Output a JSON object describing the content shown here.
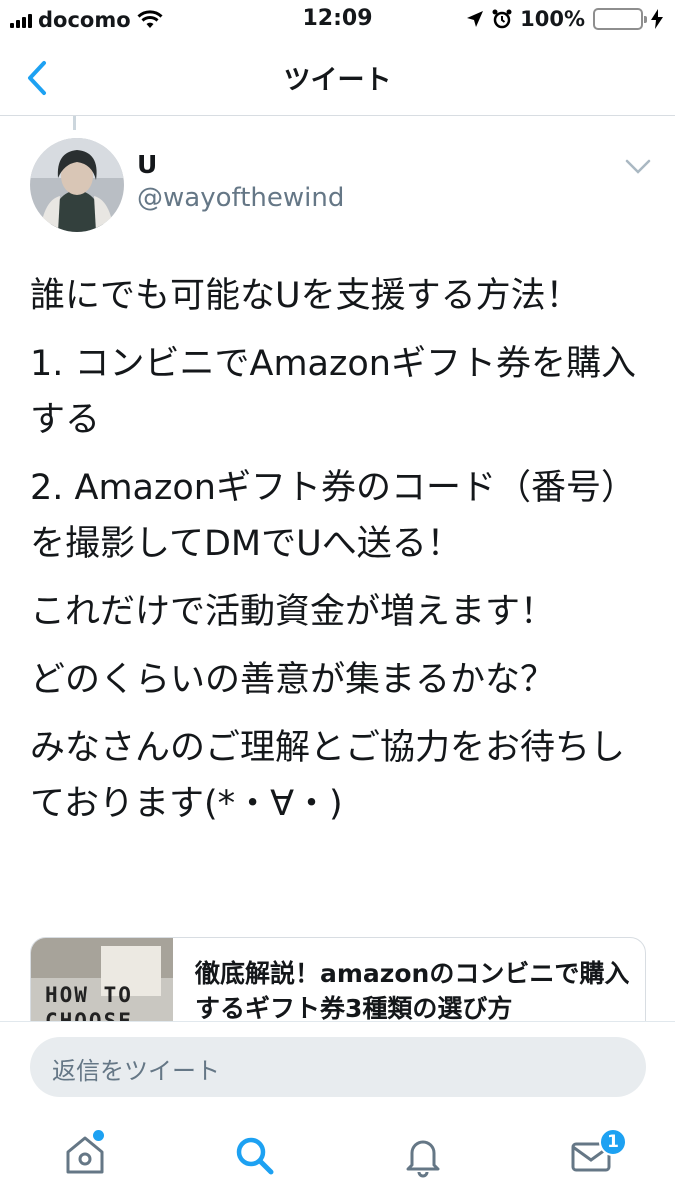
{
  "status_bar": {
    "carrier": "docomo",
    "time": "12:09",
    "battery": "100%",
    "battery_level": 1.0
  },
  "nav": {
    "title": "ツイート"
  },
  "tweet": {
    "author_name": "U",
    "author_handle": "@wayofthewind",
    "lines": [
      "誰にでも可能なUを支援する方法！",
      "1. コンビニでAmazonギフト券を購入する",
      "2. Amazonギフト券のコード（番号）を撮影してDMでUへ送る！",
      "これだけで活動資金が増えます！",
      "どのくらいの善意が集まるかな？",
      "みなさんのご理解とご協力をお待ちしております(*・∀・)"
    ]
  },
  "link_card": {
    "thumb_text": "HOW TO CHOOSE",
    "title": "徹底解説！amazonのコンビニで購入するギフト券3種類の選び方"
  },
  "reply": {
    "placeholder": "返信をツイート"
  },
  "tabbar": {
    "tabs": [
      {
        "icon": "home-icon",
        "active": false,
        "has_dot": true
      },
      {
        "icon": "search-icon",
        "active": true
      },
      {
        "icon": "bell-icon",
        "active": false
      },
      {
        "icon": "mail-icon",
        "active": false
      }
    ],
    "messages_badge": "1"
  },
  "colors": {
    "accent": "#1da1f2",
    "text": "#14171a",
    "secondary": "#657786",
    "battery": "#4cd964"
  }
}
